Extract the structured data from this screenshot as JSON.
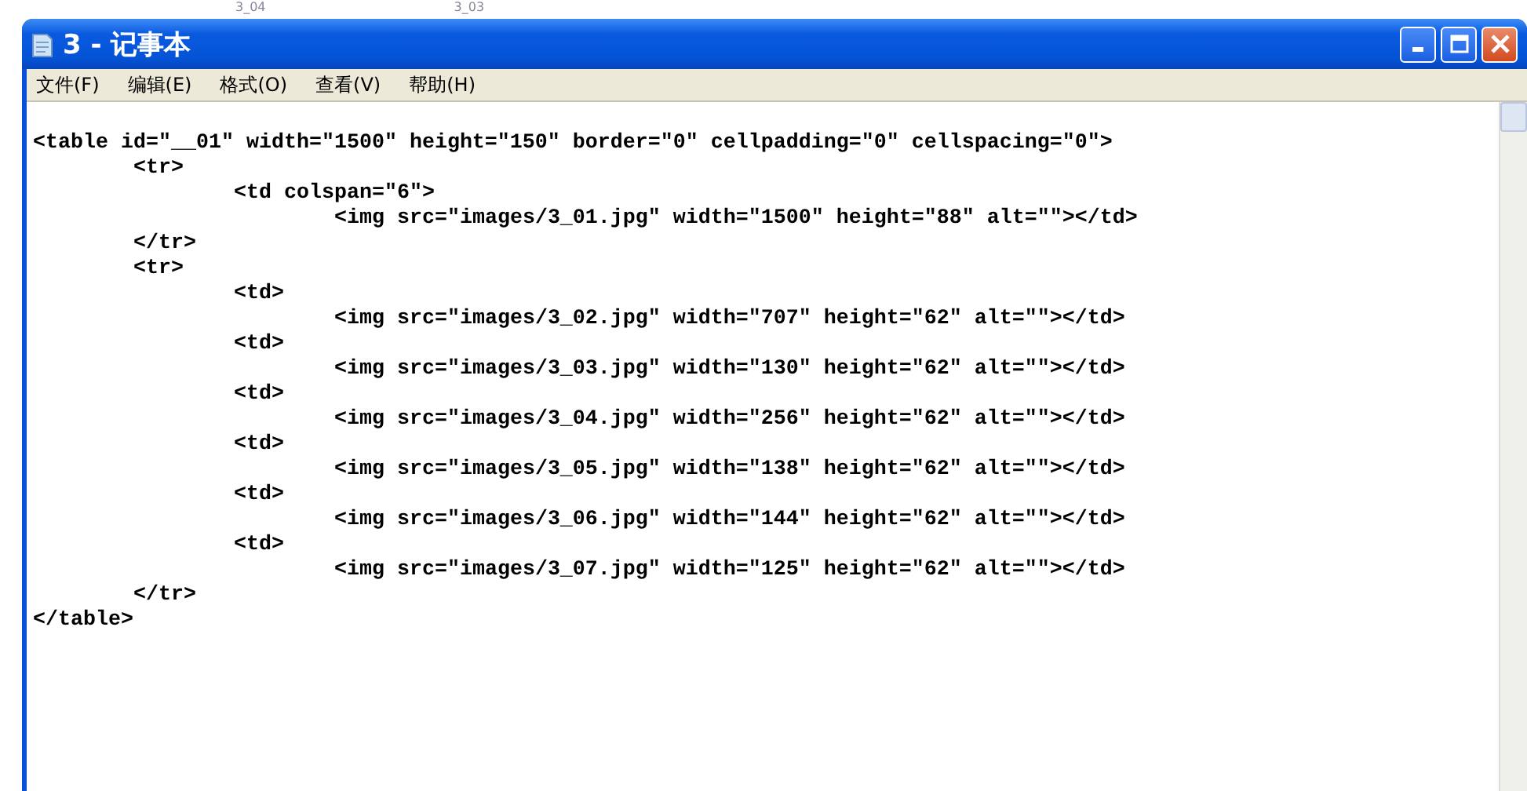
{
  "background": {
    "labels": [
      "3_04",
      "3_03"
    ]
  },
  "window": {
    "title": "3 - 记事本"
  },
  "menu": [
    "文件(F)",
    "编辑(E)",
    "格式(O)",
    "查看(V)",
    "帮助(H)"
  ],
  "editor": {
    "lines": [
      "<table id=\"__01\" width=\"1500\" height=\"150\" border=\"0\" cellpadding=\"0\" cellspacing=\"0\">",
      "\t<tr>",
      "\t\t<td colspan=\"6\">",
      "\t\t\t<img src=\"images/3_01.jpg\" width=\"1500\" height=\"88\" alt=\"\"></td>",
      "\t</tr>",
      "\t<tr>",
      "\t\t<td>",
      "\t\t\t<img src=\"images/3_02.jpg\" width=\"707\" height=\"62\" alt=\"\"></td>",
      "\t\t<td>",
      "\t\t\t<img src=\"images/3_03.jpg\" width=\"130\" height=\"62\" alt=\"\"></td>",
      "\t\t<td>",
      "\t\t\t<img src=\"images/3_04.jpg\" width=\"256\" height=\"62\" alt=\"\"></td>",
      "\t\t<td>",
      "\t\t\t<img src=\"images/3_05.jpg\" width=\"138\" height=\"62\" alt=\"\"></td>",
      "\t\t<td>",
      "\t\t\t<img src=\"images/3_06.jpg\" width=\"144\" height=\"62\" alt=\"\"></td>",
      "\t\t<td>",
      "\t\t\t<img src=\"images/3_07.jpg\" width=\"125\" height=\"62\" alt=\"\"></td>",
      "\t</tr>",
      "</table>"
    ]
  }
}
